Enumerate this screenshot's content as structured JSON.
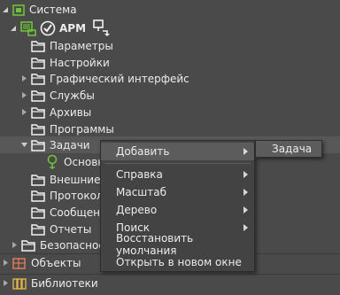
{
  "tree": {
    "root": {
      "label": "Система",
      "icon": "system-cube-icon"
    },
    "arm": {
      "label": "АРМ",
      "icons": [
        "monitor-icon",
        "check-circle-icon",
        "workstation-settings-icon"
      ]
    },
    "items": [
      {
        "label": "Параметры",
        "icon": "folder-icon"
      },
      {
        "label": "Настройки",
        "icon": "folder-icon"
      },
      {
        "label": "Графический интерфейс",
        "icon": "folder-icon"
      },
      {
        "label": "Службы",
        "icon": "folder-icon"
      },
      {
        "label": "Архивы",
        "icon": "folder-icon"
      },
      {
        "label": "Программы",
        "icon": "folder-icon"
      },
      {
        "label": "Задачи",
        "icon": "folder-icon"
      },
      {
        "label": "Основн",
        "icon": "task-pin-icon"
      },
      {
        "label": "Внешние",
        "icon": "folder-icon"
      },
      {
        "label": "Протокол",
        "icon": "folder-icon"
      },
      {
        "label": "Сообщен",
        "icon": "folder-icon"
      },
      {
        "label": "Отчеты",
        "icon": "folder-icon"
      },
      {
        "label": "Безопаснос",
        "icon": "folder-icon"
      }
    ],
    "bottom": [
      {
        "label": "Объекты",
        "icon": "objects-cube-icon"
      },
      {
        "label": "Библиотеки",
        "icon": "library-icon"
      }
    ]
  },
  "context_menu": {
    "items": [
      {
        "label": "Добавить",
        "has_submenu": true
      },
      {
        "label": "Справка",
        "has_submenu": true
      },
      {
        "label": "Масштаб",
        "has_submenu": true
      },
      {
        "label": "Дерево",
        "has_submenu": true
      },
      {
        "label": "Поиск",
        "has_submenu": true
      },
      {
        "label": "Восстановить умолчания",
        "has_submenu": false
      },
      {
        "label": "Открыть в новом окне",
        "has_submenu": false
      }
    ],
    "submenu": {
      "label": "Задача"
    }
  },
  "colors": {
    "background": "#4a4a4a",
    "selection": "#585858",
    "menu_background": "#434343",
    "menu_highlight": "#5c5c5c",
    "icon_green": "#6ec23a",
    "text": "#ececec"
  }
}
